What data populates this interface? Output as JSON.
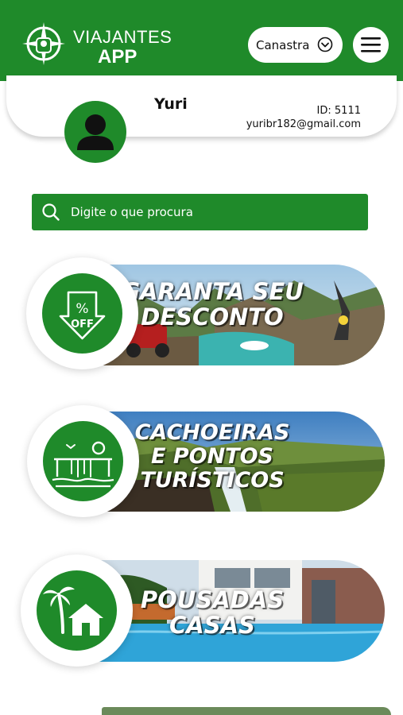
{
  "app": {
    "logo_line1": "VIAJANTES",
    "logo_line2": "APP",
    "brand_color": "#1f8a2a"
  },
  "header": {
    "city": "Canastra",
    "city_icon": "chevron-down-circle-icon",
    "menu_icon": "hamburger-menu-icon"
  },
  "profile": {
    "name": "Yuri",
    "id": "ID: 5111",
    "email": "yuribr182@gmail.com",
    "avatar_icon": "user-silhouette-icon"
  },
  "search": {
    "placeholder": "Digite o que procura",
    "icon": "search-icon"
  },
  "categories": [
    {
      "line1": "GARANTA SEU",
      "line2": "DESCONTO",
      "line3": "",
      "icon": "discount-tag-icon"
    },
    {
      "line1": "CACHOEIRAS",
      "line2": "E PONTOS",
      "line3": "TURÍSTICOS",
      "icon": "waterfall-icon"
    },
    {
      "line1": "POUSADAS",
      "line2": "CASAS",
      "line3": "",
      "icon": "palm-house-icon"
    }
  ]
}
